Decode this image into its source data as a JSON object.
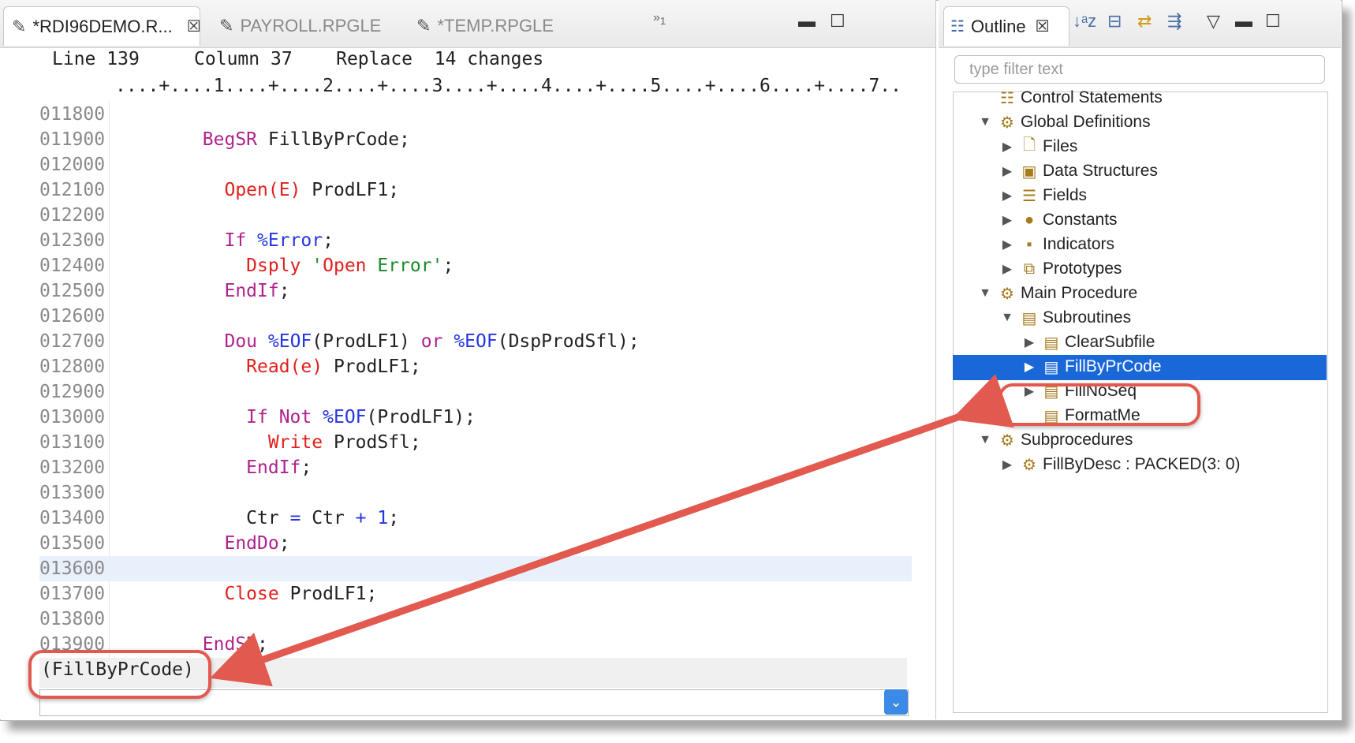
{
  "editor": {
    "tabs": [
      {
        "label": "*RDI96DEMO.R...",
        "active": true
      },
      {
        "label": "PAYROLL.RPGLE",
        "active": false
      },
      {
        "label": "*TEMP.RPGLE",
        "active": false
      }
    ],
    "overflow": "»",
    "overflow_count": "1",
    "status": {
      "line_label": "Line",
      "line": "139",
      "column_label": "Column",
      "column": "37",
      "mode": "Replace",
      "changes": "14 changes"
    },
    "ruler": "....+....1....+....2....+....3....+....4....+....5....+....6....+....7..",
    "lines": [
      {
        "num": "011800",
        "code": ""
      },
      {
        "num": "011900",
        "code": "        BegSR FillByPrCode;"
      },
      {
        "num": "012000",
        "code": ""
      },
      {
        "num": "012100",
        "code": "          Open(E) ProdLF1;"
      },
      {
        "num": "012200",
        "code": ""
      },
      {
        "num": "012300",
        "code": "          If %Error;"
      },
      {
        "num": "012400",
        "code": "            Dsply 'Open Error';"
      },
      {
        "num": "012500",
        "code": "          EndIf;"
      },
      {
        "num": "012600",
        "code": ""
      },
      {
        "num": "012700",
        "code": "          Dou %EOF(ProdLF1) or %EOF(DspProdSfl);"
      },
      {
        "num": "012800",
        "code": "            Read(e) ProdLF1;"
      },
      {
        "num": "012900",
        "code": ""
      },
      {
        "num": "013000",
        "code": "            If Not %EOF(ProdLF1);"
      },
      {
        "num": "013100",
        "code": "              Write ProdSfl;"
      },
      {
        "num": "013200",
        "code": "            EndIf;"
      },
      {
        "num": "013300",
        "code": ""
      },
      {
        "num": "013400",
        "code": "            Ctr = Ctr + 1;"
      },
      {
        "num": "013500",
        "code": "          EndDo;"
      },
      {
        "num": "013600",
        "code": ""
      },
      {
        "num": "013700",
        "code": "          Close ProdLF1;"
      },
      {
        "num": "013800",
        "code": ""
      },
      {
        "num": "013900",
        "code": "        EndSR;"
      }
    ],
    "scope_label": "(FillByPrCode)"
  },
  "outline": {
    "title": "Outline",
    "filter_placeholder": "type filter text",
    "tree": [
      {
        "label": "Control Statements",
        "icon": "control-statements-icon",
        "glyph": "☷"
      },
      {
        "label": "Global Definitions",
        "icon": "folder-gear-icon",
        "glyph": "▼"
      },
      {
        "label": "Files",
        "icon": "file-icon",
        "glyph": "▶"
      },
      {
        "label": "Data Structures",
        "icon": "folder-data-structure-icon",
        "glyph": "▶"
      },
      {
        "label": "Fields",
        "icon": "fields-icon",
        "glyph": "▶"
      },
      {
        "label": "Constants",
        "icon": "folder-constants-icon",
        "glyph": "▶"
      },
      {
        "label": "Indicators",
        "icon": "folder-indicators-icon",
        "glyph": "▶"
      },
      {
        "label": "Prototypes",
        "icon": "prototypes-icon",
        "glyph": "▶"
      },
      {
        "label": "Main Procedure",
        "icon": "folder-gear-icon",
        "glyph": "▼"
      },
      {
        "label": "Subroutines",
        "icon": "folder-subroutines-icon",
        "glyph": "▼"
      },
      {
        "label": "ClearSubfile",
        "icon": "subroutine-icon",
        "glyph": "▶"
      },
      {
        "label": "FillByPrCode",
        "icon": "subroutine-icon",
        "glyph": "▶"
      },
      {
        "label": "FillNoSeq",
        "icon": "subroutine-icon",
        "glyph": "▶"
      },
      {
        "label": "FormatMe",
        "icon": "subroutine-icon",
        "glyph": ""
      },
      {
        "label": "Subprocedures",
        "icon": "folder-gear-icon",
        "glyph": "▼"
      },
      {
        "label": "FillByDesc : PACKED(3: 0)",
        "icon": "gear-icon",
        "glyph": "▶"
      }
    ],
    "selected": "FillByPrCode"
  },
  "colors": {
    "selection": "#1a68d8",
    "annotation": "#e25a4f",
    "keyword": "#b0228c",
    "opcode": "#e0201c",
    "builtin": "#2436e0",
    "string": "#1a8b2a"
  }
}
